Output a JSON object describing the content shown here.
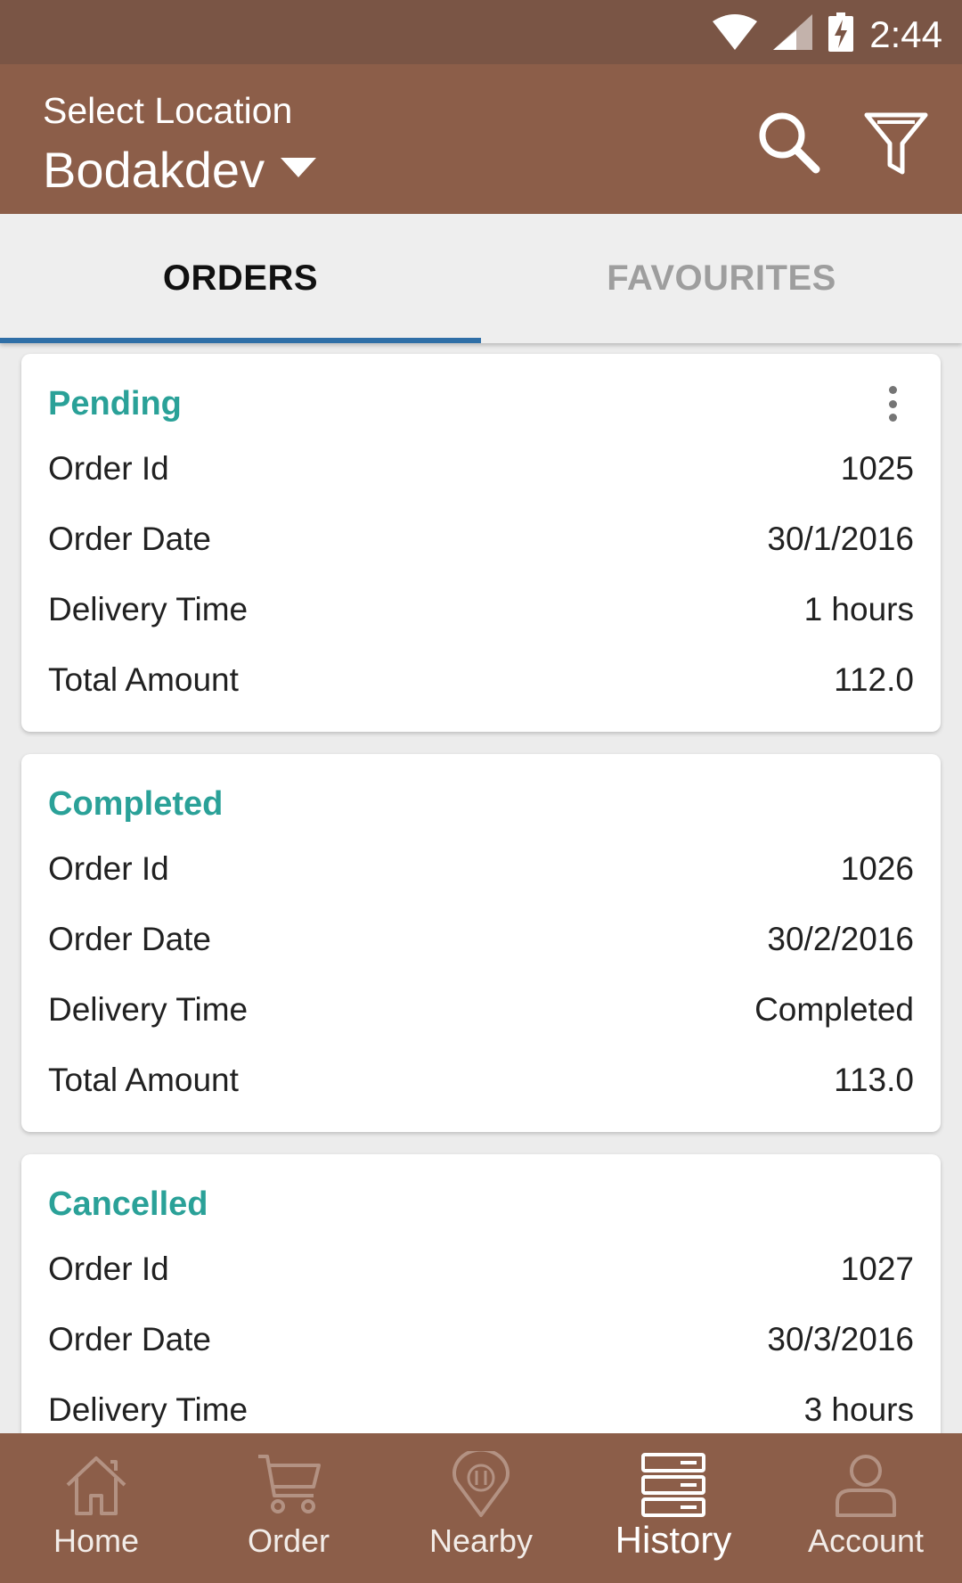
{
  "status_bar": {
    "time": "2:44"
  },
  "app_bar": {
    "location_label": "Select Location",
    "location_value": "Bodakdev"
  },
  "tabs": [
    {
      "label": "ORDERS",
      "active": true
    },
    {
      "label": "FAVOURITES",
      "active": false
    }
  ],
  "orders": [
    {
      "status": "Pending",
      "fields": [
        {
          "label": "Order Id",
          "value": "1025"
        },
        {
          "label": "Order Date",
          "value": "30/1/2016"
        },
        {
          "label": "Delivery Time",
          "value": "1 hours"
        },
        {
          "label": "Total Amount",
          "value": "112.0"
        }
      ]
    },
    {
      "status": "Completed",
      "fields": [
        {
          "label": "Order Id",
          "value": "1026"
        },
        {
          "label": "Order Date",
          "value": "30/2/2016"
        },
        {
          "label": "Delivery Time",
          "value": "Completed"
        },
        {
          "label": "Total Amount",
          "value": "113.0"
        }
      ]
    },
    {
      "status": "Cancelled",
      "fields": [
        {
          "label": "Order Id",
          "value": "1027"
        },
        {
          "label": "Order Date",
          "value": "30/3/2016"
        },
        {
          "label": "Delivery Time",
          "value": "3 hours"
        }
      ]
    }
  ],
  "bottom_nav": [
    {
      "label": "Home",
      "icon": "home-icon"
    },
    {
      "label": "Order",
      "icon": "cart-icon"
    },
    {
      "label": "Nearby",
      "icon": "nearby-pin-icon"
    },
    {
      "label": "History",
      "icon": "history-icon",
      "active": true
    },
    {
      "label": "Account",
      "icon": "account-icon"
    }
  ],
  "colors": {
    "status_bar": "#7a5545",
    "app_bar": "#8c5e49",
    "status_text": "#2aa198",
    "tab_indicator": "#2f6fa7"
  }
}
